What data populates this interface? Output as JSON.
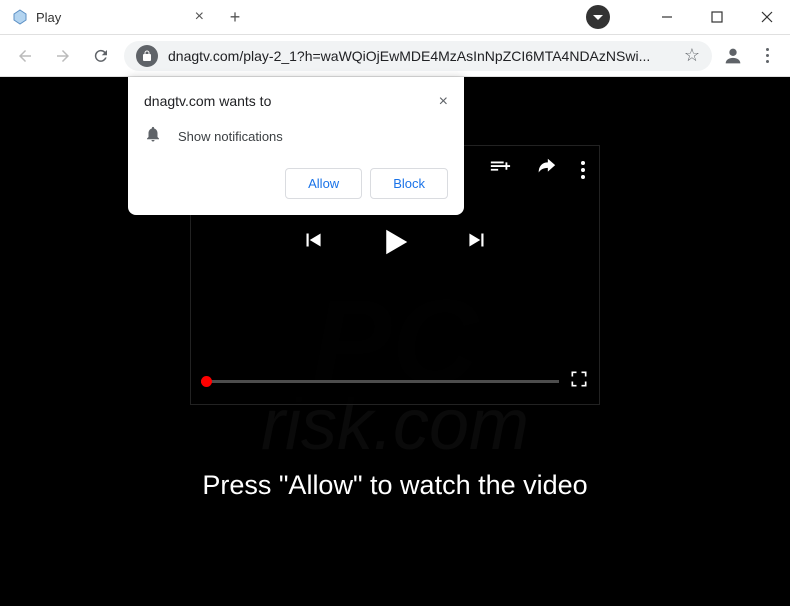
{
  "window": {
    "tab_title": "Play"
  },
  "toolbar": {
    "url": "dnagtv.com/play-2_1?h=waWQiOjEwMDE4MzAsInNpZCI6MTA4NDAzNSwi..."
  },
  "permission_popup": {
    "title": "dnagtv.com wants to",
    "message": "Show notifications",
    "allow_label": "Allow",
    "block_label": "Block"
  },
  "page": {
    "instruction": "Press \"Allow\" to watch the video"
  }
}
